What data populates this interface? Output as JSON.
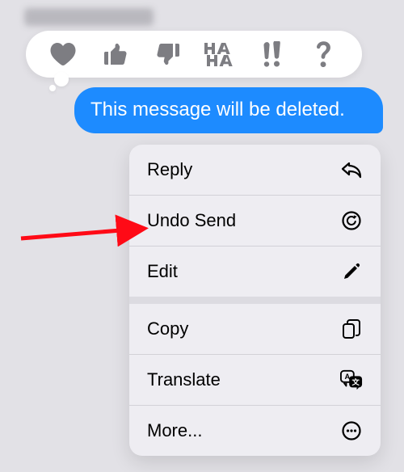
{
  "bubble_text": "This message will be deleted.",
  "reactions": {
    "heart": "heart-icon",
    "thumbs_up": "thumbs-up-icon",
    "thumbs_down": "thumbs-down-icon",
    "haha": "haha-icon",
    "exclaim": "exclaim-icon",
    "question": "question-icon"
  },
  "menu": {
    "reply": "Reply",
    "undo_send": "Undo Send",
    "edit": "Edit",
    "copy": "Copy",
    "translate": "Translate",
    "more": "More..."
  },
  "colors": {
    "bubble": "#1d8bff",
    "menu_bg": "#eeedf2",
    "arrow": "#ff0a16"
  }
}
